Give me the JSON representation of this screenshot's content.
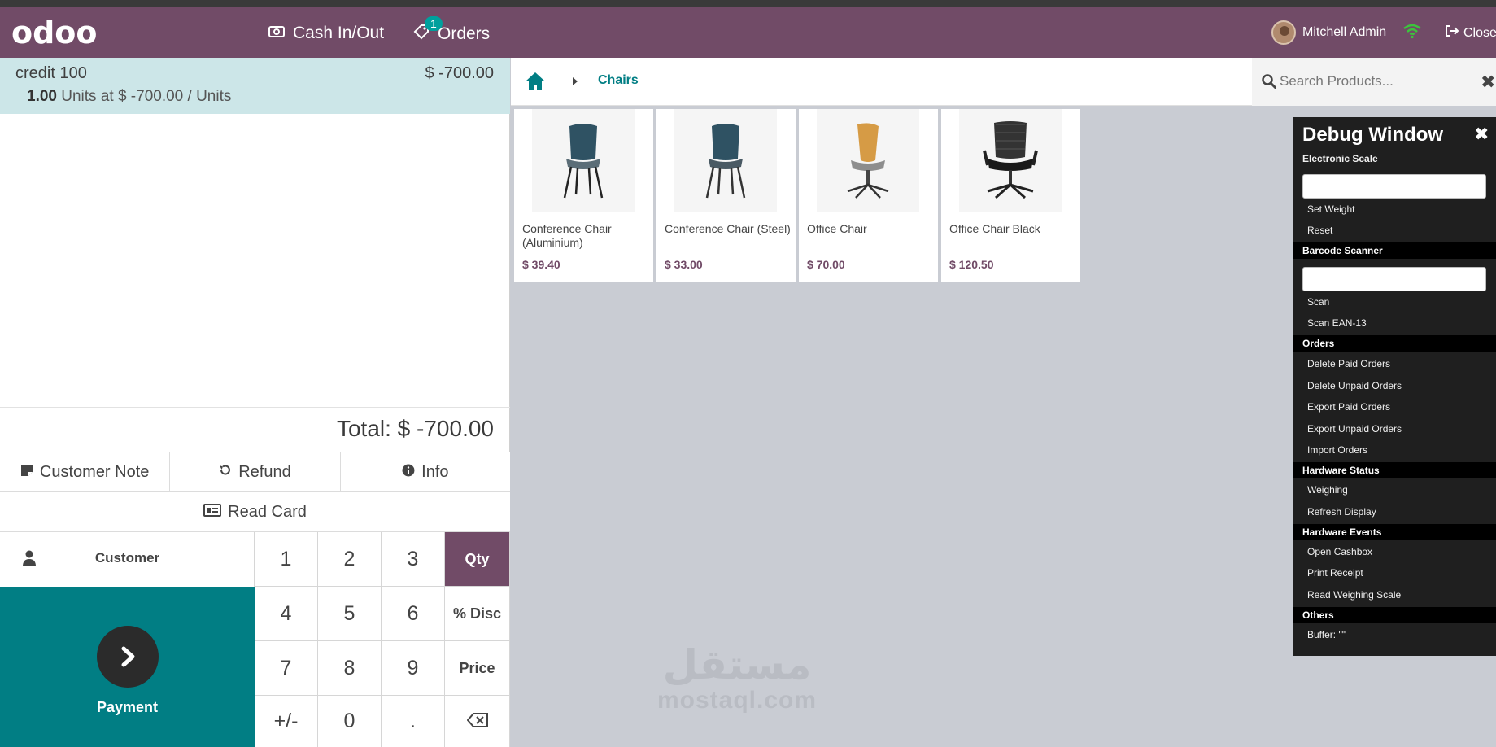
{
  "navbar": {
    "logo": "odoo",
    "cash_label": "Cash In/Out",
    "orders_label": "Orders",
    "orders_badge": "1",
    "user_name": "Mitchell Admin",
    "close_label": "Close"
  },
  "order": {
    "line_name": "credit 100",
    "line_price": "$ -700.00",
    "line_qty": "1.00",
    "line_detail": "Units at $ -700.00 / Units",
    "total": "Total: $ -700.00"
  },
  "controls": {
    "customer_note": "Customer Note",
    "refund": "Refund",
    "info": "Info",
    "read_card": "Read Card",
    "customer": "Customer",
    "payment": "Payment"
  },
  "keypad": [
    "1",
    "2",
    "3",
    "Qty",
    "4",
    "5",
    "6",
    "% Disc",
    "7",
    "8",
    "9",
    "Price",
    "+/-",
    "0",
    "."
  ],
  "breadcrumb": {
    "category": "Chairs"
  },
  "search": {
    "placeholder": "Search Products..."
  },
  "products": [
    {
      "name": "Conference Chair (Aluminium)",
      "price": "$ 39.40",
      "image": "chair-aluminium"
    },
    {
      "name": "Conference Chair (Steel)",
      "price": "$ 33.00",
      "image": "chair-steel"
    },
    {
      "name": "Office Chair",
      "price": "$ 70.00",
      "image": "office-chair-wood"
    },
    {
      "name": "Office Chair Black",
      "price": "$ 120.50",
      "image": "office-chair-black"
    }
  ],
  "debug": {
    "title": "Debug Window",
    "sections": {
      "scale": "Electronic Scale",
      "barcode": "Barcode Scanner",
      "orders": "Orders",
      "hw_status": "Hardware Status",
      "hw_events": "Hardware Events",
      "others": "Others"
    },
    "items": {
      "set_weight": "Set Weight",
      "reset": "Reset",
      "scan": "Scan",
      "scan_ean": "Scan EAN-13",
      "del_paid": "Delete Paid Orders",
      "del_unpaid": "Delete Unpaid Orders",
      "exp_paid": "Export Paid Orders",
      "exp_unpaid": "Export Unpaid Orders",
      "import": "Import Orders",
      "weighing": "Weighing",
      "refresh": "Refresh Display",
      "open_cashbox": "Open Cashbox",
      "print_receipt": "Print Receipt",
      "read_scale": "Read Weighing Scale",
      "buffer": "Buffer: \"\""
    }
  },
  "watermark": {
    "arabic": "مستقل",
    "latin": "mostaql.com"
  },
  "colors": {
    "brand": "#714b67",
    "teal": "#017e84",
    "selected_line": "#cce6e8"
  }
}
